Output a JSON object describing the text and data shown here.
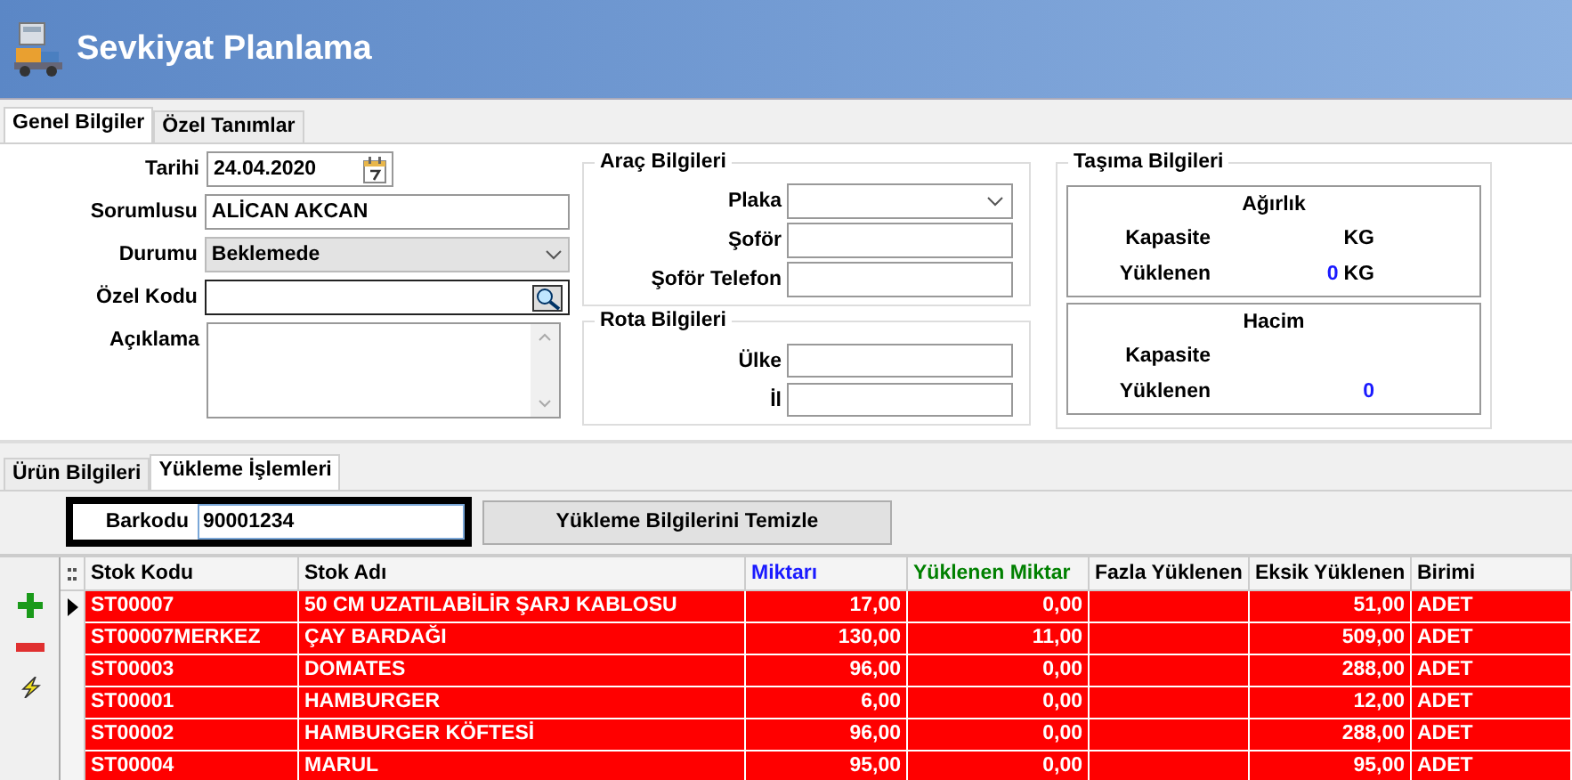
{
  "window": {
    "title": "Sevkiyat Planlama"
  },
  "top_tabs": [
    {
      "label": "Genel Bilgiler",
      "selected": true
    },
    {
      "label": "Özel Tanımlar",
      "selected": false
    }
  ],
  "general": {
    "fields": [
      {
        "label": "Tarihi",
        "value": "24.04.2020",
        "kind": "date"
      },
      {
        "label": "Sorumlusu",
        "value": "ALİCAN AKCAN",
        "kind": "text"
      },
      {
        "label": "Durumu",
        "value": "Beklemede",
        "kind": "combo"
      },
      {
        "label": "Özel Kodu",
        "kind": "lookup"
      },
      {
        "label": "Açıklama",
        "kind": "memo"
      }
    ]
  },
  "vehicle": {
    "title": "Araç Bilgileri",
    "fields": [
      {
        "label": "Plaka",
        "kind": "combo"
      },
      {
        "label": "Şoför",
        "kind": "text"
      },
      {
        "label": "Şoför Telefon",
        "kind": "text"
      }
    ]
  },
  "route": {
    "title": "Rota Bilgileri",
    "fields": [
      {
        "label": "Ülke"
      },
      {
        "label": "İl"
      }
    ]
  },
  "transport": {
    "title": "Taşıma Bilgileri",
    "boxes": [
      {
        "title": "Ağırlık",
        "rows": [
          {
            "label": "Kapasite",
            "value": "",
            "unit": "KG"
          },
          {
            "label": "Yüklenen",
            "value": "0",
            "unit": "KG"
          }
        ]
      },
      {
        "title": "Hacim",
        "rows": [
          {
            "label": "Kapasite",
            "value": "",
            "unit": ""
          },
          {
            "label": "Yüklenen",
            "value": "0",
            "unit": ""
          }
        ]
      }
    ]
  },
  "bottom_tabs": [
    {
      "label": "Ürün Bilgileri",
      "selected": false
    },
    {
      "label": "Yükleme İşlemleri",
      "selected": true
    }
  ],
  "barcode": {
    "label": "Barkodu",
    "value": "90001234"
  },
  "clear_button": "Yükleme Bilgilerini Temizle",
  "table": {
    "columns": [
      {
        "label": "Stok Kodu",
        "color": "#000000"
      },
      {
        "label": "Stok Adı",
        "color": "#000000"
      },
      {
        "label": "Miktarı",
        "color": "#1a1aff"
      },
      {
        "label": "Yüklenen Miktar",
        "color": "#008000"
      },
      {
        "label": "Fazla Yüklenen",
        "color": "#000000"
      },
      {
        "label": "Eksik Yüklenen",
        "color": "#000000"
      },
      {
        "label": "Birimi",
        "color": "#000000"
      }
    ],
    "rows": [
      {
        "selected": true,
        "cells": [
          "ST00007",
          "50 CM UZATILABİLİR ŞARJ KABLOSU",
          "17,00",
          "0,00",
          "",
          "51,00",
          "ADET"
        ]
      },
      {
        "selected": false,
        "cells": [
          "ST00007MERKEZ",
          "ÇAY BARDAĞI",
          "130,00",
          "11,00",
          "",
          "509,00",
          "ADET"
        ]
      },
      {
        "selected": false,
        "cells": [
          "ST00003",
          "DOMATES",
          "96,00",
          "0,00",
          "",
          "288,00",
          "ADET"
        ]
      },
      {
        "selected": false,
        "cells": [
          "ST00001",
          "HAMBURGER",
          "6,00",
          "0,00",
          "",
          "12,00",
          "ADET"
        ]
      },
      {
        "selected": false,
        "cells": [
          "ST00002",
          "HAMBURGER KÖFTESİ",
          "96,00",
          "0,00",
          "",
          "288,00",
          "ADET"
        ]
      },
      {
        "selected": false,
        "cells": [
          "ST00004",
          "MARUL",
          "95,00",
          "0,00",
          "",
          "95,00",
          "ADET"
        ]
      }
    ]
  }
}
